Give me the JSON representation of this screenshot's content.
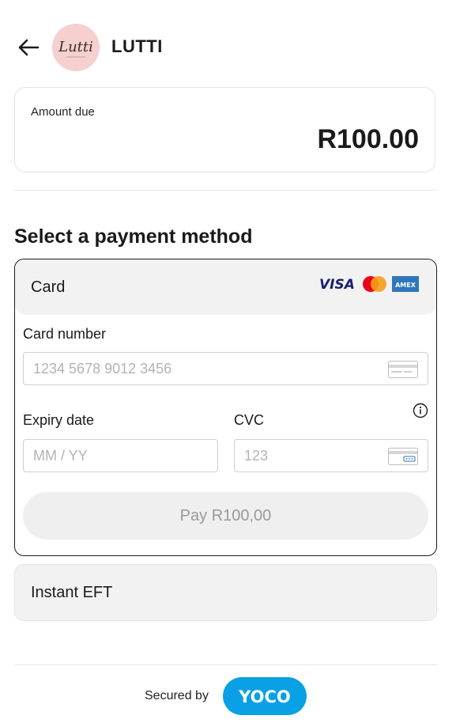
{
  "header": {
    "back_icon": "arrow-left-icon",
    "logo_text": "Lutti",
    "merchant_name": "LUTTI"
  },
  "amount": {
    "label": "Amount due",
    "value": "R100.00"
  },
  "section_title": "Select a payment method",
  "card_method": {
    "label": "Card",
    "brands": [
      "VISA",
      "Mastercard",
      "AMEX"
    ],
    "card_number_label": "Card number",
    "card_number_placeholder": "1234 5678 9012 3456",
    "expiry_label": "Expiry date",
    "expiry_placeholder": "MM / YY",
    "cvc_label": "CVC",
    "cvc_placeholder": "123",
    "info_icon": "info-icon",
    "pay_button": "Pay R100,00"
  },
  "eft_method": {
    "label": "Instant EFT"
  },
  "footer": {
    "secured_by": "Secured by",
    "brand": "YOCO"
  },
  "colors": {
    "yoco_blue": "#0aa0e6",
    "visa_blue": "#1a1f71",
    "mc_red": "#eb001b",
    "mc_orange": "#f79e1b",
    "amex_blue": "#2e77bc",
    "logo_pink": "#f6cfcf"
  }
}
